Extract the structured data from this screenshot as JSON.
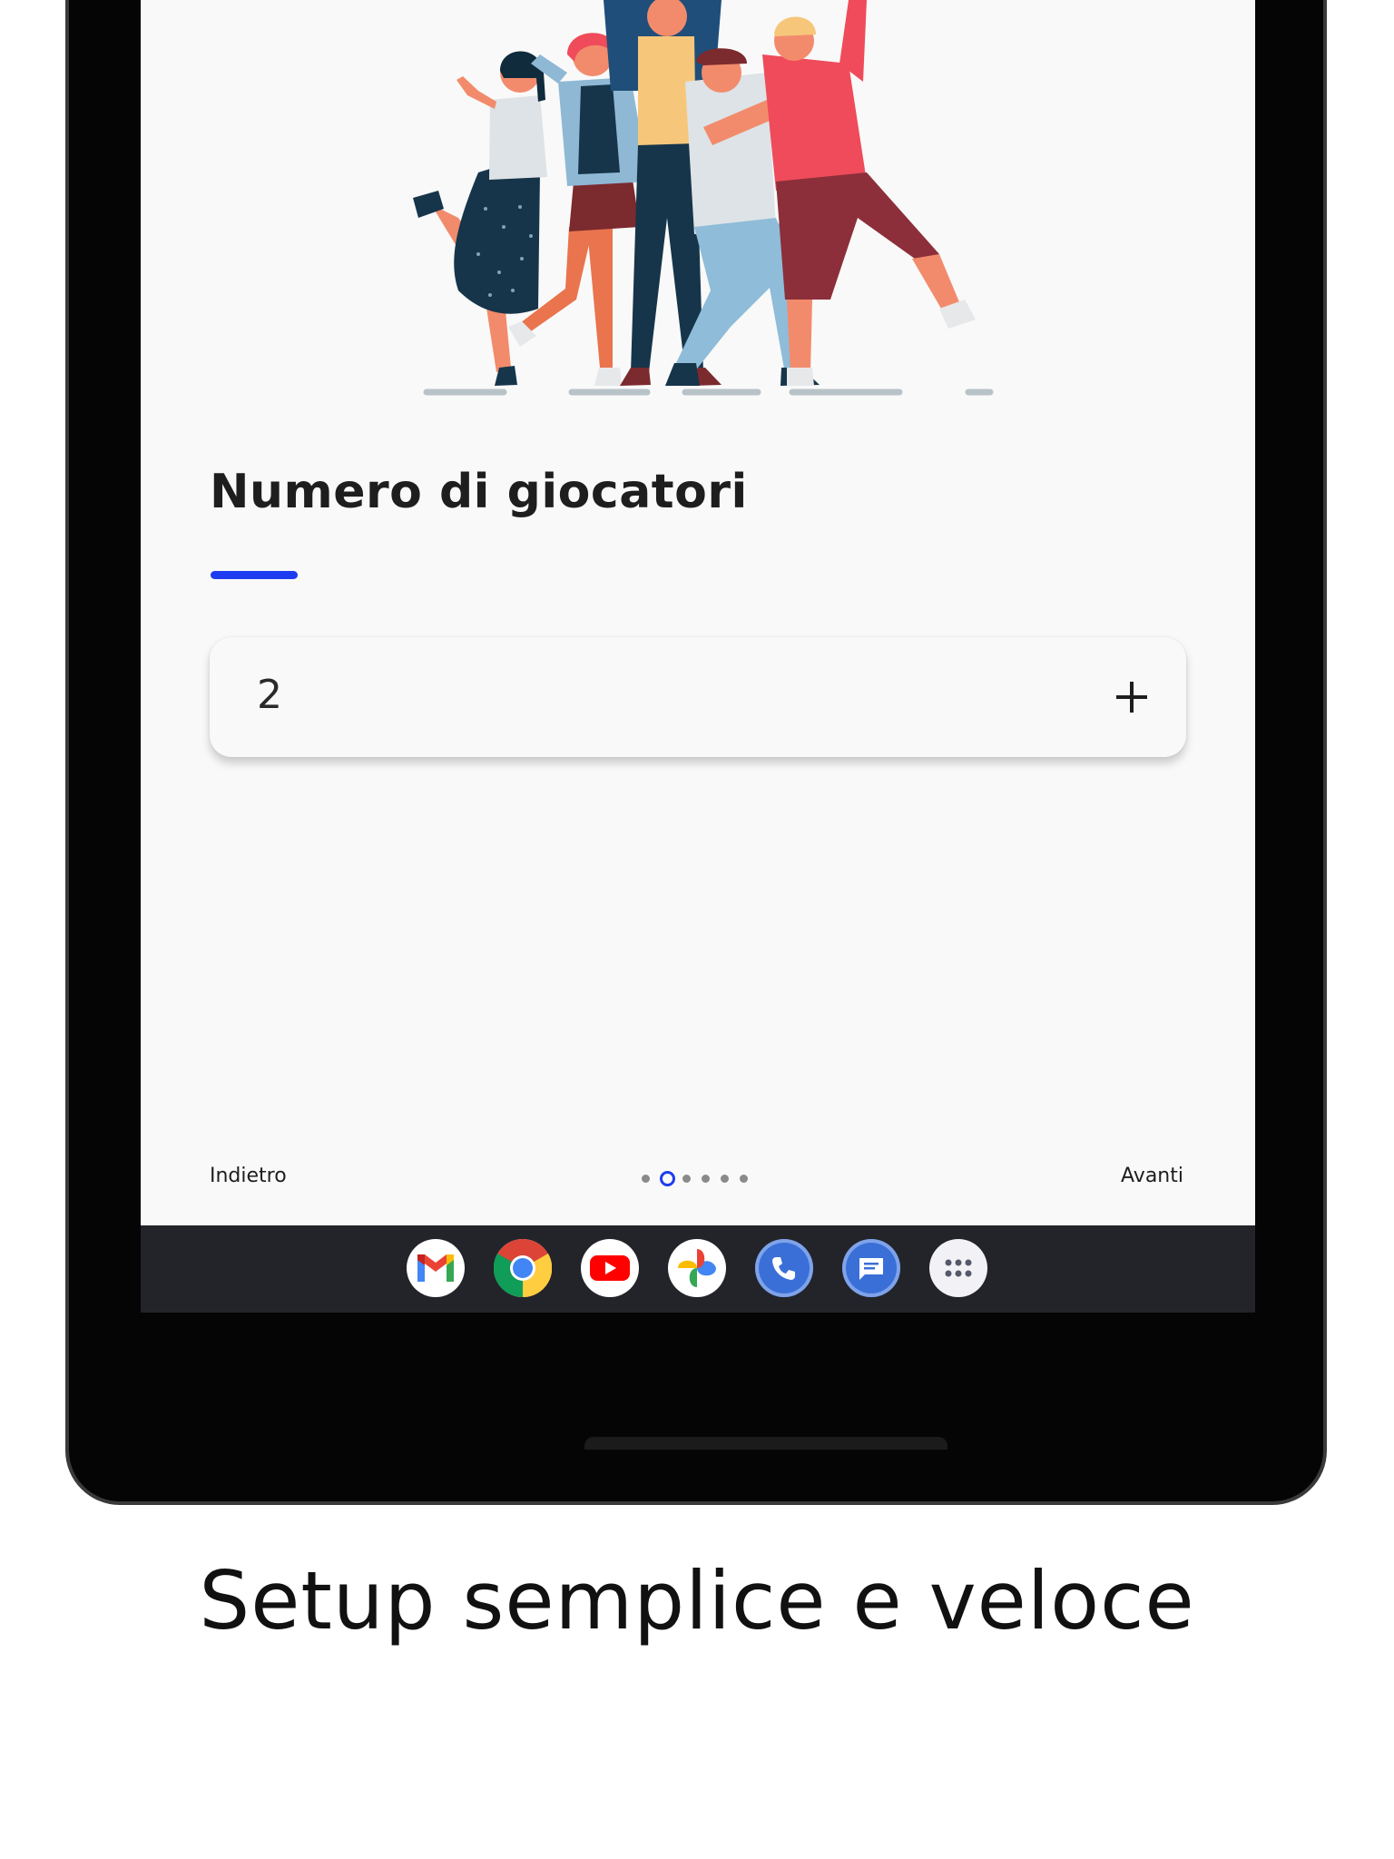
{
  "screen": {
    "title": "Numero di giocatori",
    "player_count": "2",
    "back_label": "Indietro",
    "next_label": "Avanti",
    "pager": {
      "total": 6,
      "active_index": 1
    }
  },
  "colors": {
    "accent": "#1f3df0",
    "background": "#f9f9f9",
    "taskbar": "#23242a",
    "frame": "#050505"
  },
  "taskbar": {
    "apps": [
      "gmail-icon",
      "chrome-icon",
      "youtube-icon",
      "photos-icon",
      "phone-icon",
      "messages-icon",
      "app-drawer-icon"
    ]
  },
  "caption": "Setup semplice e veloce"
}
